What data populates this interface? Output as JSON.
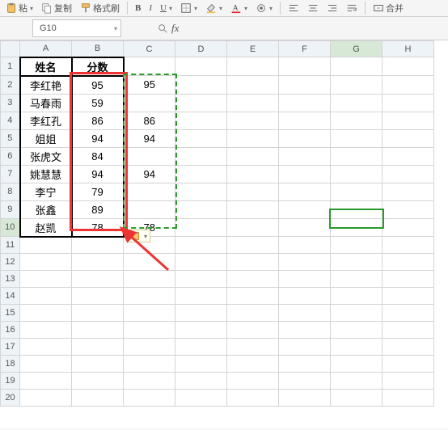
{
  "toolbar": {
    "paste_label": "粘",
    "copy_label": "复制",
    "format_painter_label": "格式刷",
    "merge_label": "合并",
    "icons": {
      "paste": "paste-icon",
      "copy": "copy-icon",
      "painter": "painter-icon",
      "bold": "B",
      "italic": "I",
      "underline": "U",
      "border": "border-icon",
      "fill": "fill-icon",
      "font_color": "font-color-icon",
      "align_left": "align-left",
      "align_center": "align-center",
      "align_right": "align-right",
      "wrap": "wrap-icon"
    }
  },
  "namebox": {
    "value": "G10"
  },
  "formula": {
    "fx": "fx",
    "value": ""
  },
  "columns": [
    "A",
    "B",
    "C",
    "D",
    "E",
    "F",
    "G",
    "H"
  ],
  "rows": 20,
  "active_cell": {
    "col": "G",
    "row": 10
  },
  "chart_data": {
    "type": "table",
    "headers": {
      "A": "姓名",
      "B": "分数"
    },
    "rows": [
      {
        "name": "李红艳",
        "score": 95,
        "c": 95
      },
      {
        "name": "马春雨",
        "score": 59,
        "c": ""
      },
      {
        "name": "李红孔",
        "score": 86,
        "c": 86
      },
      {
        "name": "姐姐",
        "score": 94,
        "c": 94
      },
      {
        "name": "张虎文",
        "score": 84,
        "c": ""
      },
      {
        "name": "姚慧慧",
        "score": 94,
        "c": 94
      },
      {
        "name": "李宁",
        "score": 79,
        "c": ""
      },
      {
        "name": "张鑫",
        "score": 89,
        "c": ""
      },
      {
        "name": "赵凯",
        "score": 78,
        "c": 78
      }
    ]
  },
  "paste_options": {
    "icon": "clipboard-icon"
  }
}
